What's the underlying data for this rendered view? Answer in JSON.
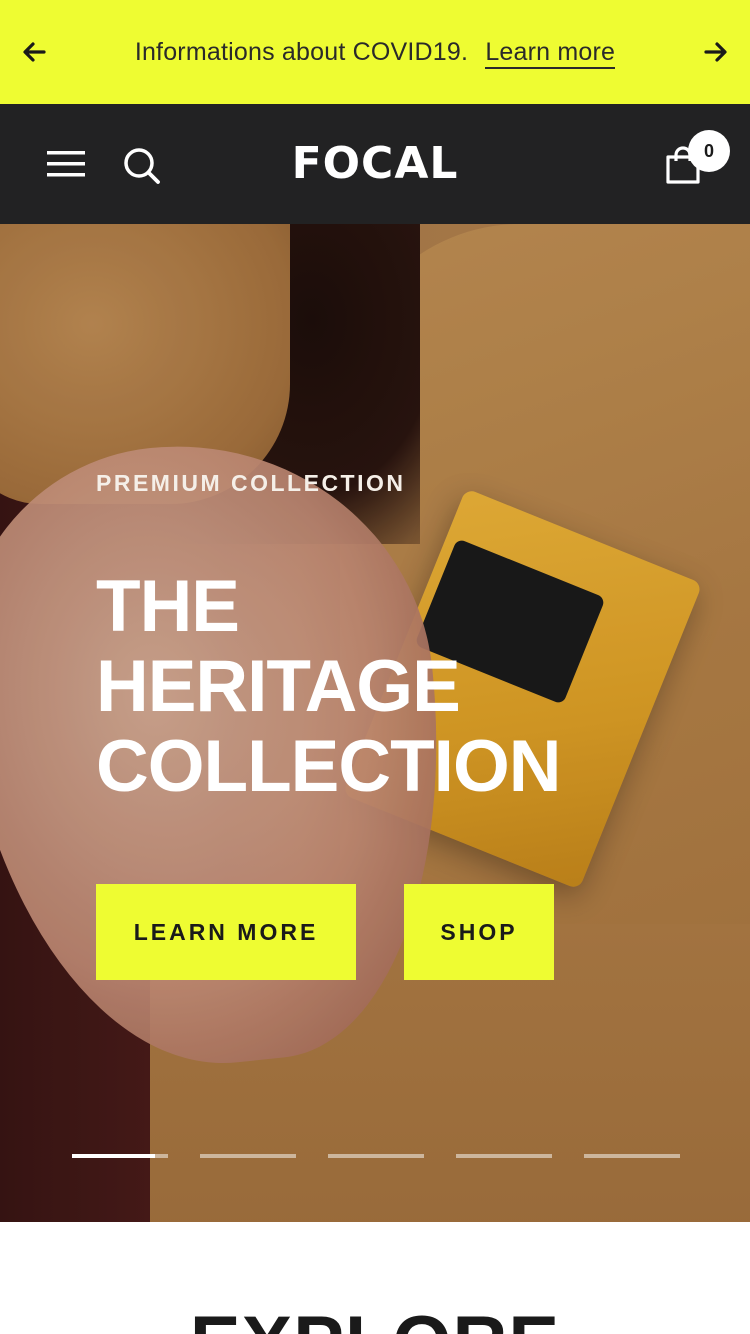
{
  "announcement": {
    "message": "Informations about COVID19.",
    "link_label": "Learn more",
    "prev_icon": "arrow-left-icon",
    "next_icon": "arrow-right-icon",
    "background_color": "#eefc32"
  },
  "header": {
    "logo": "FOCAL",
    "menu_icon": "hamburger-menu-icon",
    "search_icon": "search-icon",
    "cart_icon": "shopping-bag-icon",
    "cart_count": "0",
    "background_color": "#222223"
  },
  "hero": {
    "subheading": "PREMIUM COLLECTION",
    "title_lines": [
      "THE",
      "HERITAGE",
      "COLLECTION"
    ],
    "buttons": {
      "learn_more": "LEARN MORE",
      "shop": "SHOP"
    },
    "slides": {
      "count": 5,
      "active_index": 0,
      "active_progress": 0.86
    },
    "accent_color": "#eefc32"
  },
  "explore": {
    "heading": "EXPLORE"
  }
}
